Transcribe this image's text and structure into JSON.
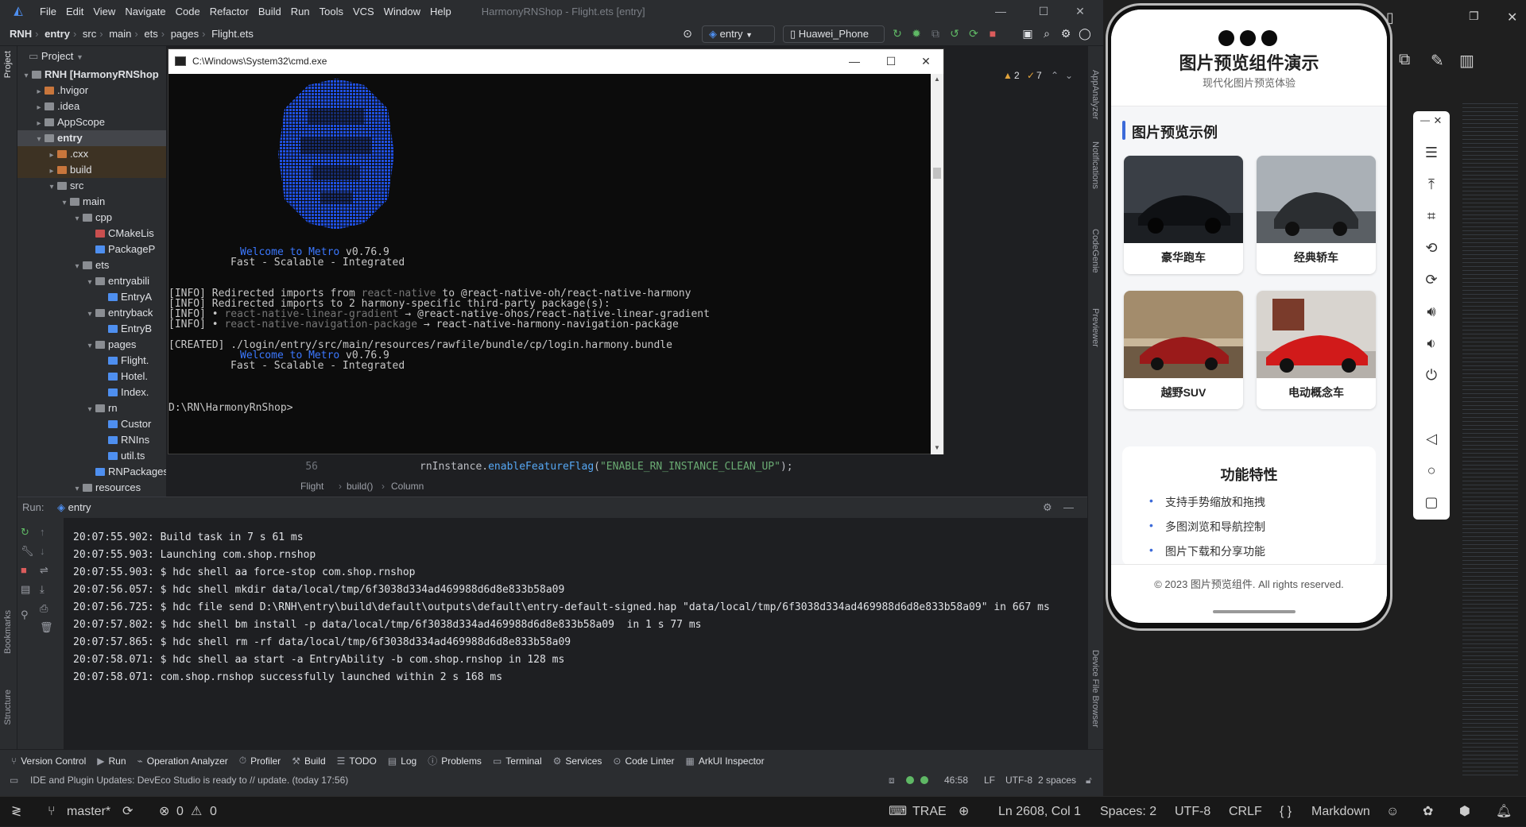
{
  "ide": {
    "menu": [
      "File",
      "Edit",
      "View",
      "Navigate",
      "Code",
      "Refactor",
      "Build",
      "Run",
      "Tools",
      "VCS",
      "Window",
      "Help"
    ],
    "window_title": "HarmonyRNShop - Flight.ets [entry]",
    "breadcrumb": [
      "RNH",
      "entry",
      "src",
      "main",
      "ets",
      "pages",
      "Flight.ets"
    ],
    "run_config": "entry",
    "device": "Huawei_Phone",
    "inspections": {
      "warnings": "2",
      "weak": "7"
    },
    "project_panel_title": "Project",
    "tree": [
      {
        "label": "RNH [HarmonyRNShop",
        "indent": 0,
        "open": true,
        "color": "#8a8d92",
        "bold": true
      },
      {
        "label": ".hvigor",
        "indent": 1,
        "open": false,
        "color": "#c8763c"
      },
      {
        "label": ".idea",
        "indent": 1,
        "open": false,
        "color": "#8a8d92"
      },
      {
        "label": "AppScope",
        "indent": 1,
        "open": false,
        "color": "#8a8d92"
      },
      {
        "label": "entry",
        "indent": 1,
        "open": true,
        "color": "#8a8d92",
        "bold": true,
        "sel": true
      },
      {
        "label": ".cxx",
        "indent": 2,
        "open": false,
        "color": "#c8763c",
        "hl": true
      },
      {
        "label": "build",
        "indent": 2,
        "open": false,
        "color": "#c8763c",
        "hl": true
      },
      {
        "label": "src",
        "indent": 2,
        "open": true,
        "color": "#8a8d92"
      },
      {
        "label": "main",
        "indent": 3,
        "open": true,
        "color": "#8a8d92"
      },
      {
        "label": "cpp",
        "indent": 4,
        "open": true,
        "color": "#8a8d92"
      },
      {
        "label": "CMakeLis",
        "indent": 5,
        "leaf": true,
        "color": "#c94f4f"
      },
      {
        "label": "PackageP",
        "indent": 5,
        "leaf": true,
        "color": "#4e8ff0"
      },
      {
        "label": "ets",
        "indent": 4,
        "open": true,
        "color": "#8a8d92"
      },
      {
        "label": "entryabili",
        "indent": 5,
        "open": true,
        "color": "#8a8d92"
      },
      {
        "label": "EntryA",
        "indent": 6,
        "leaf": true,
        "color": "#4e8ff0"
      },
      {
        "label": "entryback",
        "indent": 5,
        "open": true,
        "color": "#8a8d92"
      },
      {
        "label": "EntryB",
        "indent": 6,
        "leaf": true,
        "color": "#4e8ff0"
      },
      {
        "label": "pages",
        "indent": 5,
        "open": true,
        "color": "#8a8d92"
      },
      {
        "label": "Flight.",
        "indent": 6,
        "leaf": true,
        "color": "#4e8ff0"
      },
      {
        "label": "Hotel.",
        "indent": 6,
        "leaf": true,
        "color": "#4e8ff0"
      },
      {
        "label": "Index.",
        "indent": 6,
        "leaf": true,
        "color": "#4e8ff0"
      },
      {
        "label": "rn",
        "indent": 5,
        "open": true,
        "color": "#8a8d92"
      },
      {
        "label": "Custor",
        "indent": 6,
        "leaf": true,
        "color": "#4e8ff0"
      },
      {
        "label": "RNIns",
        "indent": 6,
        "leaf": true,
        "color": "#4e8ff0"
      },
      {
        "label": "util.ts",
        "indent": 6,
        "leaf": true,
        "color": "#4e8ff0"
      },
      {
        "label": "RNPackagesFactory.ets",
        "indent": 5,
        "leaf": true,
        "color": "#4e8ff0"
      },
      {
        "label": "resources",
        "indent": 4,
        "open": true,
        "color": "#8a8d92"
      }
    ],
    "left_strip_labels": [
      "Project",
      "Bookmarks",
      "Structure"
    ],
    "right_strip_labels": [
      "AppAnalyzer",
      "Notifications",
      "CodeGenie",
      "Previewer",
      "Device File Browser"
    ],
    "code_line_number": "56",
    "code_line_prefix": "rnInstance.",
    "code_line_method": "enableFeatureFlag",
    "code_line_arg": "\"ENABLE_RN_INSTANCE_CLEAN_UP\"",
    "code_line_suffix": ");",
    "editor_breadcrumb": [
      "Flight",
      "build()",
      "Column"
    ],
    "run_panel": {
      "label": "Run:",
      "tab": "entry",
      "log": [
        "20:07:55.902: Build task in 7 s 61 ms",
        "20:07:55.903: Launching com.shop.rnshop",
        "20:07:55.903: $ hdc shell aa force-stop com.shop.rnshop",
        "20:07:56.057: $ hdc shell mkdir data/local/tmp/6f3038d334ad469988d6d8e833b58a09",
        "20:07:56.725: $ hdc file send D:\\RNH\\entry\\build\\default\\outputs\\default\\entry-default-signed.hap \"data/local/tmp/6f3038d334ad469988d6d8e833b58a09\" in 667 ms",
        "20:07:57.802: $ hdc shell bm install -p data/local/tmp/6f3038d334ad469988d6d8e833b58a09  in 1 s 77 ms",
        "20:07:57.865: $ hdc shell rm -rf data/local/tmp/6f3038d334ad469988d6d8e833b58a09",
        "20:07:58.071: $ hdc shell aa start -a EntryAbility -b com.shop.rnshop in 128 ms",
        "20:07:58.071: com.shop.rnshop successfully launched within 2 s 168 ms"
      ]
    },
    "tool_windows": [
      {
        "icon": "⑂",
        "label": "Version Control"
      },
      {
        "icon": "▶",
        "label": "Run"
      },
      {
        "icon": "⌁",
        "label": "Operation Analyzer"
      },
      {
        "icon": "⏱",
        "label": "Profiler"
      },
      {
        "icon": "⚒",
        "label": "Build"
      },
      {
        "icon": "☰",
        "label": "TODO"
      },
      {
        "icon": "▤",
        "label": "Log"
      },
      {
        "icon": "ⓘ",
        "label": "Problems"
      },
      {
        "icon": "▭",
        "label": "Terminal"
      },
      {
        "icon": "⚙",
        "label": "Services"
      },
      {
        "icon": "⊙",
        "label": "Code Linter"
      },
      {
        "icon": "▦",
        "label": "ArkUI Inspector"
      }
    ],
    "status": {
      "message": "IDE and Plugin Updates: DevEco Studio is ready to // update. (today 17:56)",
      "position": "46:58",
      "line_sep": "LF",
      "encoding": "UTF-8",
      "indent": "2 spaces"
    }
  },
  "cmd": {
    "title": "C:\\Windows\\System32\\cmd.exe",
    "welcome_prefix": "Welcome to Metro",
    "version": " v0.76.9",
    "tagline": "Fast - Scalable - Integrated",
    "info1_a": "[INFO] Redirected imports from ",
    "info1_b": "react-native",
    "info1_c": " to @react-native-oh/react-native-harmony",
    "info2": "[INFO] Redirected imports to 2 harmony-specific third-party package(s):",
    "info3_a": "[INFO] • ",
    "info3_b": "react-native-linear-gradient",
    "info3_c": " → @react-native-ohos/react-native-linear-gradient",
    "info4_a": "[INFO] • ",
    "info4_b": "react-native-navigation-package",
    "info4_c": " → react-native-harmony-navigation-package",
    "created": "[CREATED] ./login/entry/src/main/resources/rawfile/bundle/cp/login.harmony.bundle",
    "prompt": "D:\\RN\\HarmonyRnShop>"
  },
  "app": {
    "title": "图片预览组件演示",
    "subtitle": "现代化图片预览体验",
    "section_title": "图片预览示例",
    "cards": [
      {
        "caption": "豪华跑车"
      },
      {
        "caption": "经典轿车"
      },
      {
        "caption": "越野SUV"
      },
      {
        "caption": "电动概念车"
      }
    ],
    "features_title": "功能特性",
    "features": [
      "支持手势缩放和拖拽",
      "多图浏览和导航控制",
      "图片下载和分享功能"
    ],
    "copyright": "© 2023 图片预览组件. All rights reserved."
  },
  "vscode_status": {
    "branch": "master*",
    "errors": "0",
    "warnings": "0",
    "trae": "TRAE",
    "cursor": "Ln 2608, Col 1",
    "spaces": "Spaces: 2",
    "encoding": "UTF-8",
    "eol": "CRLF",
    "language": "Markdown"
  },
  "colors": {
    "accent": "#3c6ad9",
    "ide_bg": "#2b2d30",
    "editor_bg": "#1e1f22",
    "metro_blue": "#3b78ff"
  }
}
